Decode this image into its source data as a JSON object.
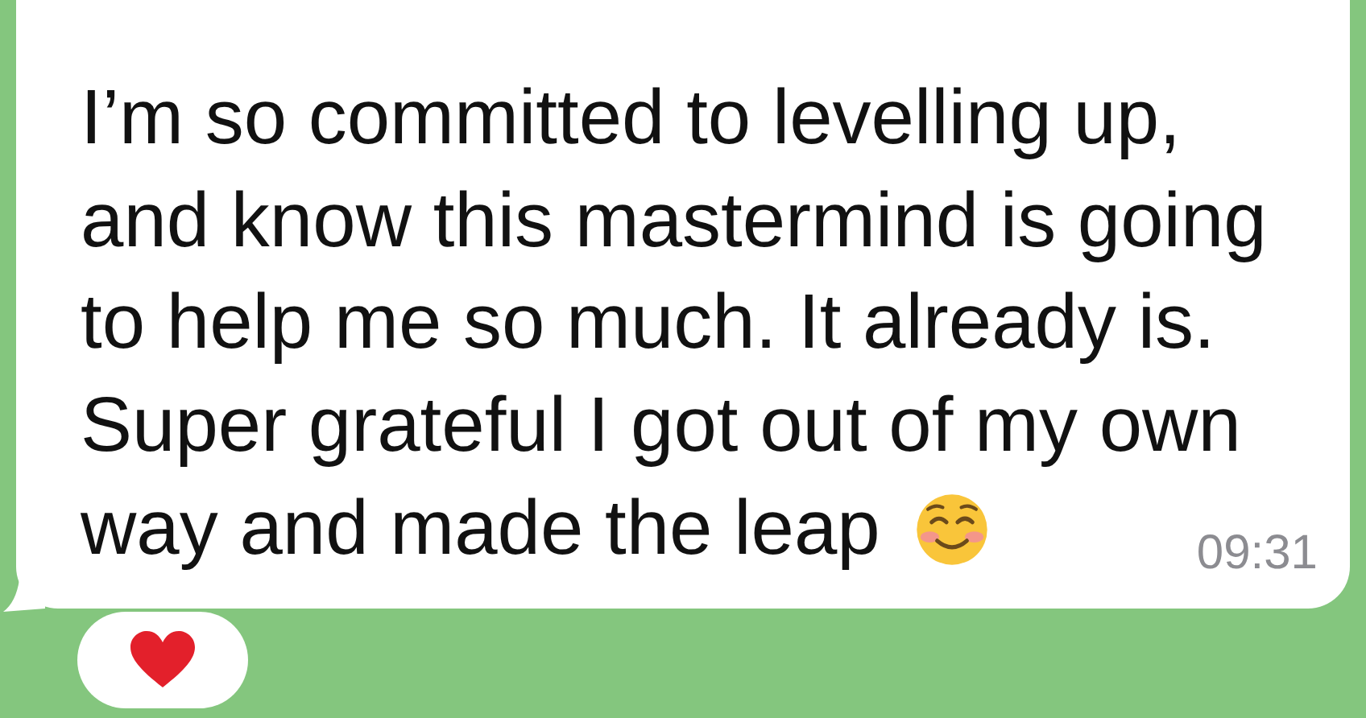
{
  "message": {
    "lines": [
      "I’m so committed to levelling up,",
      "and know this mastermind is going",
      "to help me so much. It already is.",
      "Super grateful I got out of my own",
      "way and made the leap"
    ],
    "time": "09:31"
  },
  "reactions": [
    {
      "kind": "heart"
    }
  ]
}
